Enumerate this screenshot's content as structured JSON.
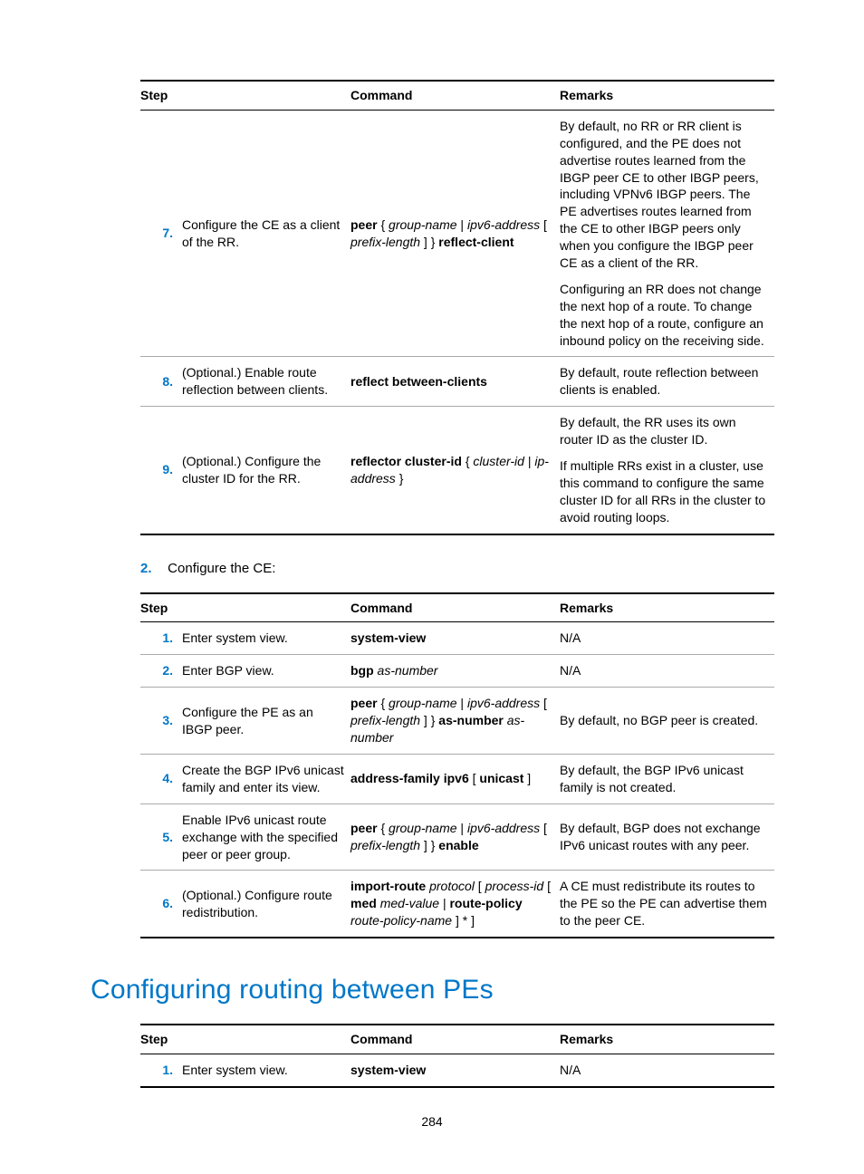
{
  "pageNumber": "284",
  "table1": {
    "headers": {
      "step": "Step",
      "command": "Command",
      "remarks": "Remarks"
    },
    "rows": [
      {
        "num": "7.",
        "desc": "Configure the CE as a client of the RR.",
        "cmd": [
          {
            "t": "peer",
            "b": true
          },
          {
            "t": " { "
          },
          {
            "t": "group-name",
            "i": true
          },
          {
            "t": " | "
          },
          {
            "t": "ipv6-address",
            "i": true
          },
          {
            "t": " [ "
          },
          {
            "t": "prefix-length",
            "i": true
          },
          {
            "t": " ] } "
          },
          {
            "t": "reflect-client",
            "b": true
          }
        ],
        "remarks": [
          "By default, no RR or RR client is configured, and the PE does not advertise routes learned from the IBGP peer CE to other IBGP peers, including VPNv6 IBGP peers. The PE advertises routes learned from the CE to other IBGP peers only when you configure the IBGP peer CE as a client of the RR.",
          "Configuring an RR does not change the next hop of a route. To change the next hop of a route, configure an inbound policy on the receiving side."
        ]
      },
      {
        "num": "8.",
        "desc": "(Optional.) Enable route reflection between clients.",
        "cmd": [
          {
            "t": "reflect between-clients",
            "b": true
          }
        ],
        "remarks": [
          "By default, route reflection between clients is enabled."
        ]
      },
      {
        "num": "9.",
        "desc": "(Optional.) Configure the cluster ID for the RR.",
        "cmd": [
          {
            "t": "reflector cluster-id",
            "b": true
          },
          {
            "t": " { "
          },
          {
            "t": "cluster-id",
            "i": true
          },
          {
            "t": " | "
          },
          {
            "t": "ip-address",
            "i": true
          },
          {
            "t": " }"
          }
        ],
        "remarks": [
          "By default, the RR uses its own router ID as the cluster ID.",
          "If multiple RRs exist in a cluster, use this command to configure the same cluster ID for all RRs in the cluster to avoid routing loops."
        ]
      }
    ]
  },
  "interStep": {
    "num": "2.",
    "text": "Configure the CE:"
  },
  "table2": {
    "headers": {
      "step": "Step",
      "command": "Command",
      "remarks": "Remarks"
    },
    "rows": [
      {
        "num": "1.",
        "desc": "Enter system view.",
        "cmd": [
          {
            "t": "system-view",
            "b": true
          }
        ],
        "remarks": [
          "N/A"
        ]
      },
      {
        "num": "2.",
        "desc": "Enter BGP view.",
        "cmd": [
          {
            "t": "bgp",
            "b": true
          },
          {
            "t": " "
          },
          {
            "t": "as-number",
            "i": true
          }
        ],
        "remarks": [
          "N/A"
        ]
      },
      {
        "num": "3.",
        "desc": "Configure the PE as an IBGP peer.",
        "cmd": [
          {
            "t": "peer",
            "b": true
          },
          {
            "t": " { "
          },
          {
            "t": "group-name",
            "i": true
          },
          {
            "t": " | "
          },
          {
            "t": "ipv6-address",
            "i": true
          },
          {
            "t": " [ "
          },
          {
            "t": "prefix-length",
            "i": true
          },
          {
            "t": " ] } "
          },
          {
            "t": "as-number",
            "b": true
          },
          {
            "t": " "
          },
          {
            "t": "as-number",
            "i": true
          }
        ],
        "remarks": [
          "By default, no BGP peer is created."
        ]
      },
      {
        "num": "4.",
        "desc": "Create the BGP IPv6 unicast family and enter its view.",
        "cmd": [
          {
            "t": "address-family ipv6",
            "b": true
          },
          {
            "t": " [ "
          },
          {
            "t": "unicast",
            "b": true
          },
          {
            "t": " ]"
          }
        ],
        "remarks": [
          "By default, the BGP IPv6 unicast family is not created."
        ]
      },
      {
        "num": "5.",
        "desc": "Enable IPv6 unicast route exchange with the specified peer or peer group.",
        "cmd": [
          {
            "t": "peer",
            "b": true
          },
          {
            "t": " { "
          },
          {
            "t": "group-name",
            "i": true
          },
          {
            "t": " | "
          },
          {
            "t": "ipv6-address",
            "i": true
          },
          {
            "t": " [ "
          },
          {
            "t": "prefix-length",
            "i": true
          },
          {
            "t": " ] } "
          },
          {
            "t": "enable",
            "b": true
          }
        ],
        "remarks": [
          "By default, BGP does not exchange IPv6 unicast routes with any peer."
        ]
      },
      {
        "num": "6.",
        "desc": "(Optional.) Configure route redistribution.",
        "cmd": [
          {
            "t": "import-route",
            "b": true
          },
          {
            "t": " "
          },
          {
            "t": "protocol",
            "i": true
          },
          {
            "t": " [ "
          },
          {
            "t": "process-id",
            "i": true
          },
          {
            "t": " [ "
          },
          {
            "t": "med",
            "b": true
          },
          {
            "t": " "
          },
          {
            "t": "med-value",
            "i": true
          },
          {
            "t": " | "
          },
          {
            "t": "route-policy",
            "b": true
          },
          {
            "t": " "
          },
          {
            "t": "route-policy-name",
            "i": true
          },
          {
            "t": " ] * ]"
          }
        ],
        "remarks": [
          "A CE must redistribute its routes to the PE so the PE can advertise them to the peer CE."
        ]
      }
    ]
  },
  "sectionHeading": "Configuring routing between PEs",
  "table3": {
    "headers": {
      "step": "Step",
      "command": "Command",
      "remarks": "Remarks"
    },
    "rows": [
      {
        "num": "1.",
        "desc": "Enter system view.",
        "cmd": [
          {
            "t": "system-view",
            "b": true
          }
        ],
        "remarks": [
          "N/A"
        ]
      }
    ]
  }
}
